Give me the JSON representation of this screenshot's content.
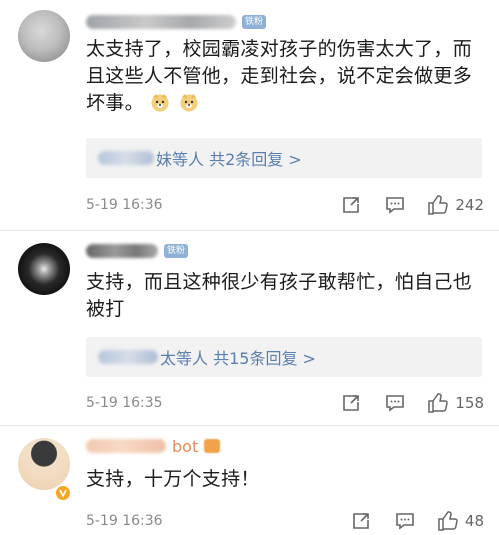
{
  "comments": [
    {
      "text": "太支持了，校园霸凌对孩子的伤害太大了，而且这些人不管他，走到社会，说不定会做更多坏事。",
      "badge": "铁粉",
      "reply_summary": "妹等人 共2条回复 >",
      "time": "5-19 16:36",
      "likes": "242",
      "emojis": [
        "doge-emoji",
        "doge-emoji"
      ]
    },
    {
      "text": "支持，而且这种很少有孩子敢帮忙，怕自己也被打",
      "badge": "铁粉",
      "reply_summary": "太等人 共15条回复 >",
      "time": "5-19 16:35",
      "likes": "158"
    },
    {
      "text": "支持，十万个支持！",
      "username_visible": "bot",
      "time": "5-19 16:36",
      "likes": "48"
    }
  ],
  "colors": {
    "link": "#5a7fb0",
    "meta_gray": "#8a8a8a",
    "reply_bg": "#f2f2f2"
  },
  "icons": [
    "share-icon",
    "comment-icon",
    "like-icon",
    "doge-emoji",
    "gold-v-badge-icon"
  ]
}
